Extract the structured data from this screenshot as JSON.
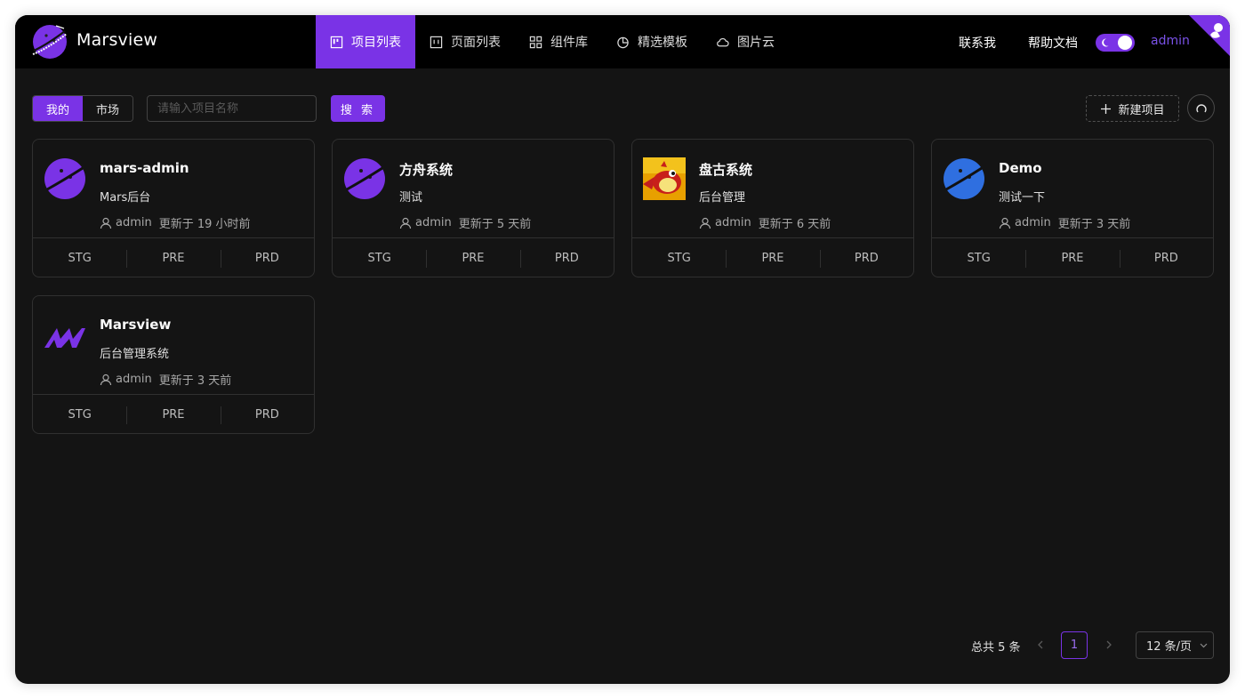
{
  "header": {
    "brand": "Marsview",
    "nav": [
      {
        "label": "项目列表",
        "icon": "kanban-icon",
        "active": true
      },
      {
        "label": "页面列表",
        "icon": "page-icon",
        "active": false
      },
      {
        "label": "组件库",
        "icon": "grid-icon",
        "active": false
      },
      {
        "label": "精选模板",
        "icon": "pie-chart-icon",
        "active": false
      },
      {
        "label": "图片云",
        "icon": "cloud-icon",
        "active": false
      }
    ],
    "contact": "联系我",
    "help": "帮助文档",
    "theme_toggle": "dark",
    "user": "admin"
  },
  "toolbar": {
    "tab_mine": "我的",
    "tab_market": "市场",
    "search_placeholder": "请输入项目名称",
    "search_label": "搜 索",
    "new_label": "新建项目"
  },
  "projects": [
    {
      "title": "mars-admin",
      "desc": "Mars后台",
      "owner": "admin",
      "updated": "更新于 19 小时前",
      "avatar": "purple-planet-icon",
      "envs": [
        "STG",
        "PRE",
        "PRD"
      ]
    },
    {
      "title": "方舟系统",
      "desc": "测试",
      "owner": "admin",
      "updated": "更新于 5 天前",
      "avatar": "purple-planet-icon",
      "envs": [
        "STG",
        "PRE",
        "PRD"
      ]
    },
    {
      "title": "盘古系统",
      "desc": "后台管理",
      "owner": "admin",
      "updated": "更新于 6 天前",
      "avatar": "cartoon-bird-icon",
      "envs": [
        "STG",
        "PRE",
        "PRD"
      ]
    },
    {
      "title": "Demo",
      "desc": "测试一下",
      "owner": "admin",
      "updated": "更新于 3 天前",
      "avatar": "blue-planet-icon",
      "envs": [
        "STG",
        "PRE",
        "PRD"
      ]
    },
    {
      "title": "Marsview",
      "desc": "后台管理系统",
      "owner": "admin",
      "updated": "更新于 3 天前",
      "avatar": "marsview-m-logo-icon",
      "envs": [
        "STG",
        "PRE",
        "PRD"
      ]
    }
  ],
  "pagination": {
    "total": "总共 5 条",
    "current": "1",
    "page_size": "12 条/页"
  },
  "colors": {
    "accent": "#7a33e6",
    "background": "#141414",
    "header": "#000000",
    "blue_planet": "#2f6fe0"
  }
}
